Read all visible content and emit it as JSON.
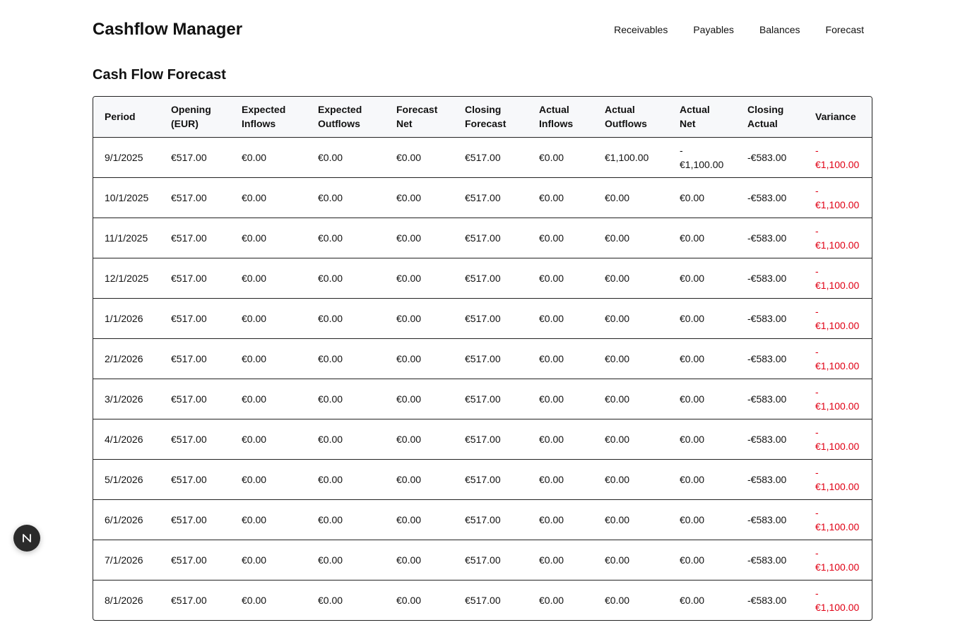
{
  "app": {
    "title": "Cashflow Manager"
  },
  "nav": {
    "items": [
      {
        "label": "Receivables"
      },
      {
        "label": "Payables"
      },
      {
        "label": "Balances"
      },
      {
        "label": "Forecast"
      }
    ]
  },
  "section": {
    "title": "Cash Flow Forecast"
  },
  "table": {
    "headers": [
      {
        "line1": "Period",
        "line2": ""
      },
      {
        "line1": "Opening",
        "line2": "(EUR)"
      },
      {
        "line1": "Expected",
        "line2": "Inflows"
      },
      {
        "line1": "Expected",
        "line2": "Outflows"
      },
      {
        "line1": "Forecast",
        "line2": "Net"
      },
      {
        "line1": "Closing",
        "line2": "Forecast"
      },
      {
        "line1": "Actual",
        "line2": "Inflows"
      },
      {
        "line1": "Actual",
        "line2": "Outflows"
      },
      {
        "line1": "Actual",
        "line2": "Net"
      },
      {
        "line1": "Closing",
        "line2": "Actual"
      },
      {
        "line1": "Variance",
        "line2": ""
      }
    ],
    "rows": [
      [
        "9/1/2025",
        "€517.00",
        "€0.00",
        "€0.00",
        "€0.00",
        "€517.00",
        "€0.00",
        "€1,100.00",
        "-€1,100.00",
        "-€583.00",
        "-€1,100.00"
      ],
      [
        "10/1/2025",
        "€517.00",
        "€0.00",
        "€0.00",
        "€0.00",
        "€517.00",
        "€0.00",
        "€0.00",
        "€0.00",
        "-€583.00",
        "-€1,100.00"
      ],
      [
        "11/1/2025",
        "€517.00",
        "€0.00",
        "€0.00",
        "€0.00",
        "€517.00",
        "€0.00",
        "€0.00",
        "€0.00",
        "-€583.00",
        "-€1,100.00"
      ],
      [
        "12/1/2025",
        "€517.00",
        "€0.00",
        "€0.00",
        "€0.00",
        "€517.00",
        "€0.00",
        "€0.00",
        "€0.00",
        "-€583.00",
        "-€1,100.00"
      ],
      [
        "1/1/2026",
        "€517.00",
        "€0.00",
        "€0.00",
        "€0.00",
        "€517.00",
        "€0.00",
        "€0.00",
        "€0.00",
        "-€583.00",
        "-€1,100.00"
      ],
      [
        "2/1/2026",
        "€517.00",
        "€0.00",
        "€0.00",
        "€0.00",
        "€517.00",
        "€0.00",
        "€0.00",
        "€0.00",
        "-€583.00",
        "-€1,100.00"
      ],
      [
        "3/1/2026",
        "€517.00",
        "€0.00",
        "€0.00",
        "€0.00",
        "€517.00",
        "€0.00",
        "€0.00",
        "€0.00",
        "-€583.00",
        "-€1,100.00"
      ],
      [
        "4/1/2026",
        "€517.00",
        "€0.00",
        "€0.00",
        "€0.00",
        "€517.00",
        "€0.00",
        "€0.00",
        "€0.00",
        "-€583.00",
        "-€1,100.00"
      ],
      [
        "5/1/2026",
        "€517.00",
        "€0.00",
        "€0.00",
        "€0.00",
        "€517.00",
        "€0.00",
        "€0.00",
        "€0.00",
        "-€583.00",
        "-€1,100.00"
      ],
      [
        "6/1/2026",
        "€517.00",
        "€0.00",
        "€0.00",
        "€0.00",
        "€517.00",
        "€0.00",
        "€0.00",
        "€0.00",
        "-€583.00",
        "-€1,100.00"
      ],
      [
        "7/1/2026",
        "€517.00",
        "€0.00",
        "€0.00",
        "€0.00",
        "€517.00",
        "€0.00",
        "€0.00",
        "€0.00",
        "-€583.00",
        "-€1,100.00"
      ],
      [
        "8/1/2026",
        "€517.00",
        "€0.00",
        "€0.00",
        "€0.00",
        "€517.00",
        "€0.00",
        "€0.00",
        "€0.00",
        "-€583.00",
        "-€1,100.00"
      ]
    ]
  },
  "colors": {
    "negative": "#e00014",
    "header_bg": "#f7f8fa",
    "badge_bg": "#2b2b2b"
  },
  "badge": {
    "icon": "next-logo-icon",
    "letter": "N"
  }
}
